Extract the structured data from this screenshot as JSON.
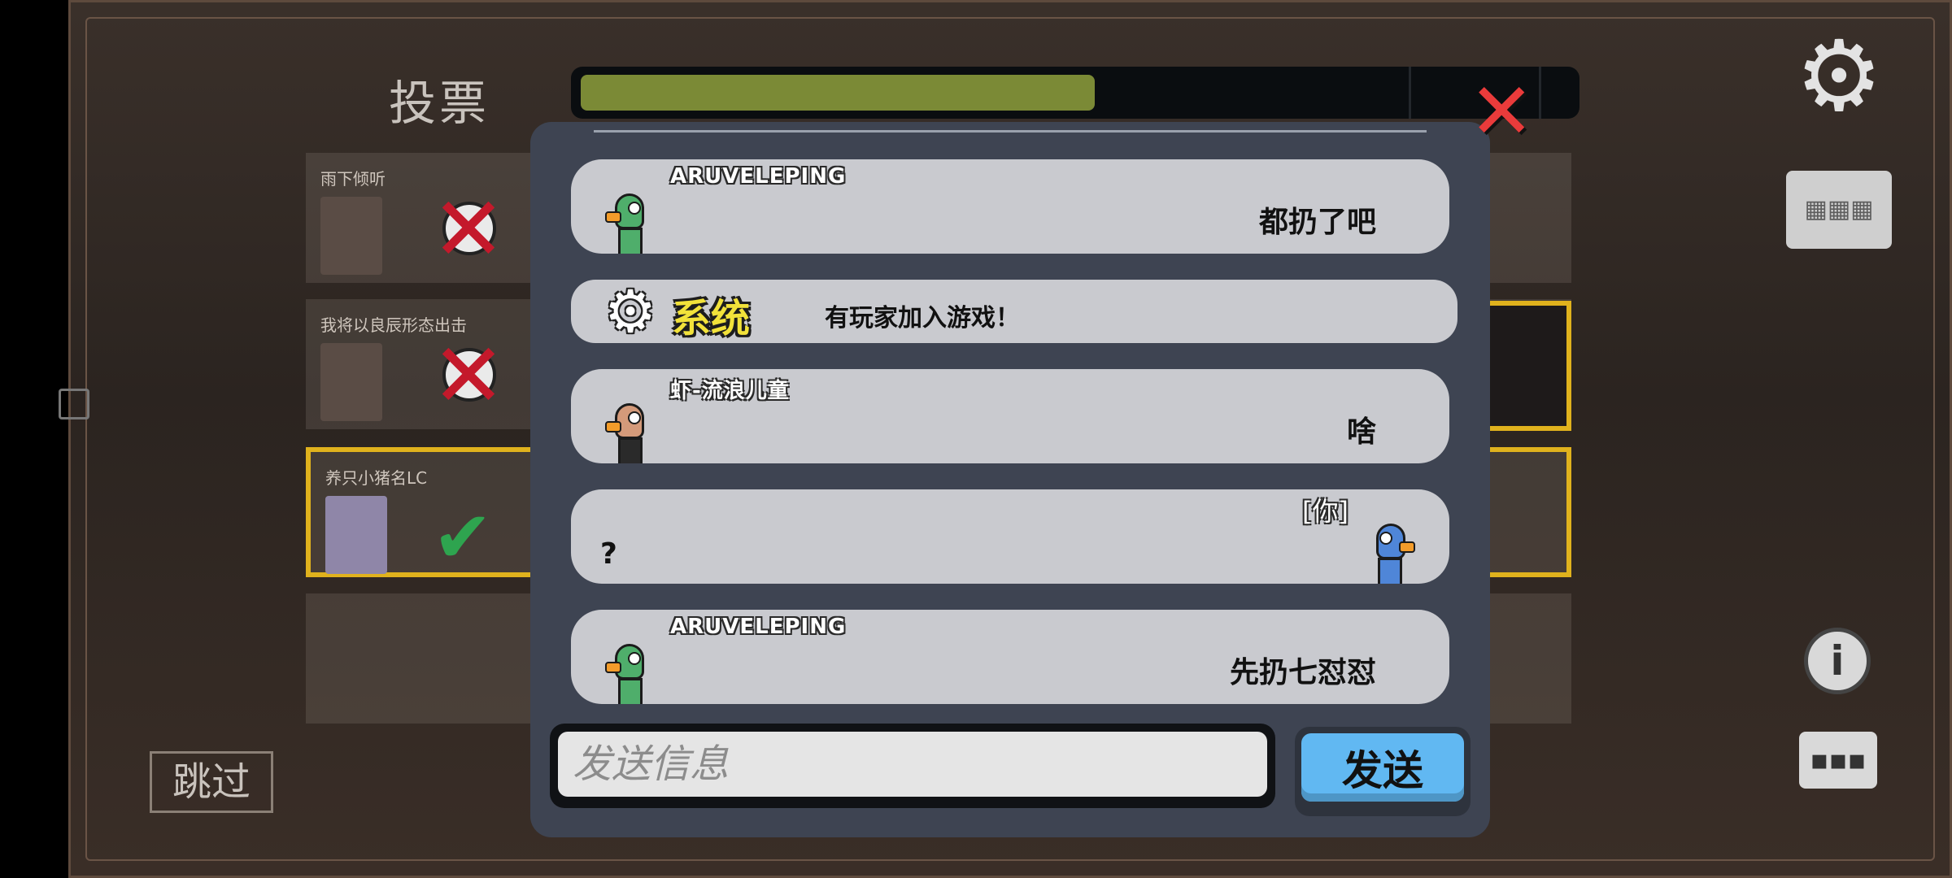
{
  "voting": {
    "title": "投票",
    "timer_progress": 0.52,
    "skip_label": "跳过",
    "players": [
      {
        "name": "雨下倾听",
        "status": "dead"
      },
      {
        "name": "我将以良辰形态出击",
        "status": "dead"
      },
      {
        "name": "养只小猪名LC",
        "status": "voted",
        "selected": true
      }
    ]
  },
  "chat": {
    "messages": [
      {
        "sender": "ARUVELEPING",
        "text": "都扔了吧",
        "avatar_color": "#4fae6b"
      },
      {
        "system": true,
        "label": "系统",
        "text": "有玩家加入游戏！"
      },
      {
        "sender": "虾-流浪儿童",
        "text": "啥",
        "avatar_color": "#d49a7a"
      },
      {
        "self": true,
        "you_tag": "[你]",
        "text": "?",
        "avatar_color": "#4f86d8"
      },
      {
        "sender": "ARUVELEPING",
        "text": "先扔七怼怼",
        "avatar_color": "#4fae6b"
      }
    ],
    "input_placeholder": "发送信息",
    "send_label": "发送"
  },
  "icons": {
    "settings": "gear-icon",
    "map": "map-icon",
    "info": "info-icon",
    "chat": "chat-icon",
    "close": "close-icon"
  },
  "colors": {
    "timer_fill": "#7b8a36",
    "send_button": "#61b8f2",
    "close_x": "#ea3b3b",
    "system_label": "#f2e23a",
    "selected_border": "#e0b21d"
  }
}
